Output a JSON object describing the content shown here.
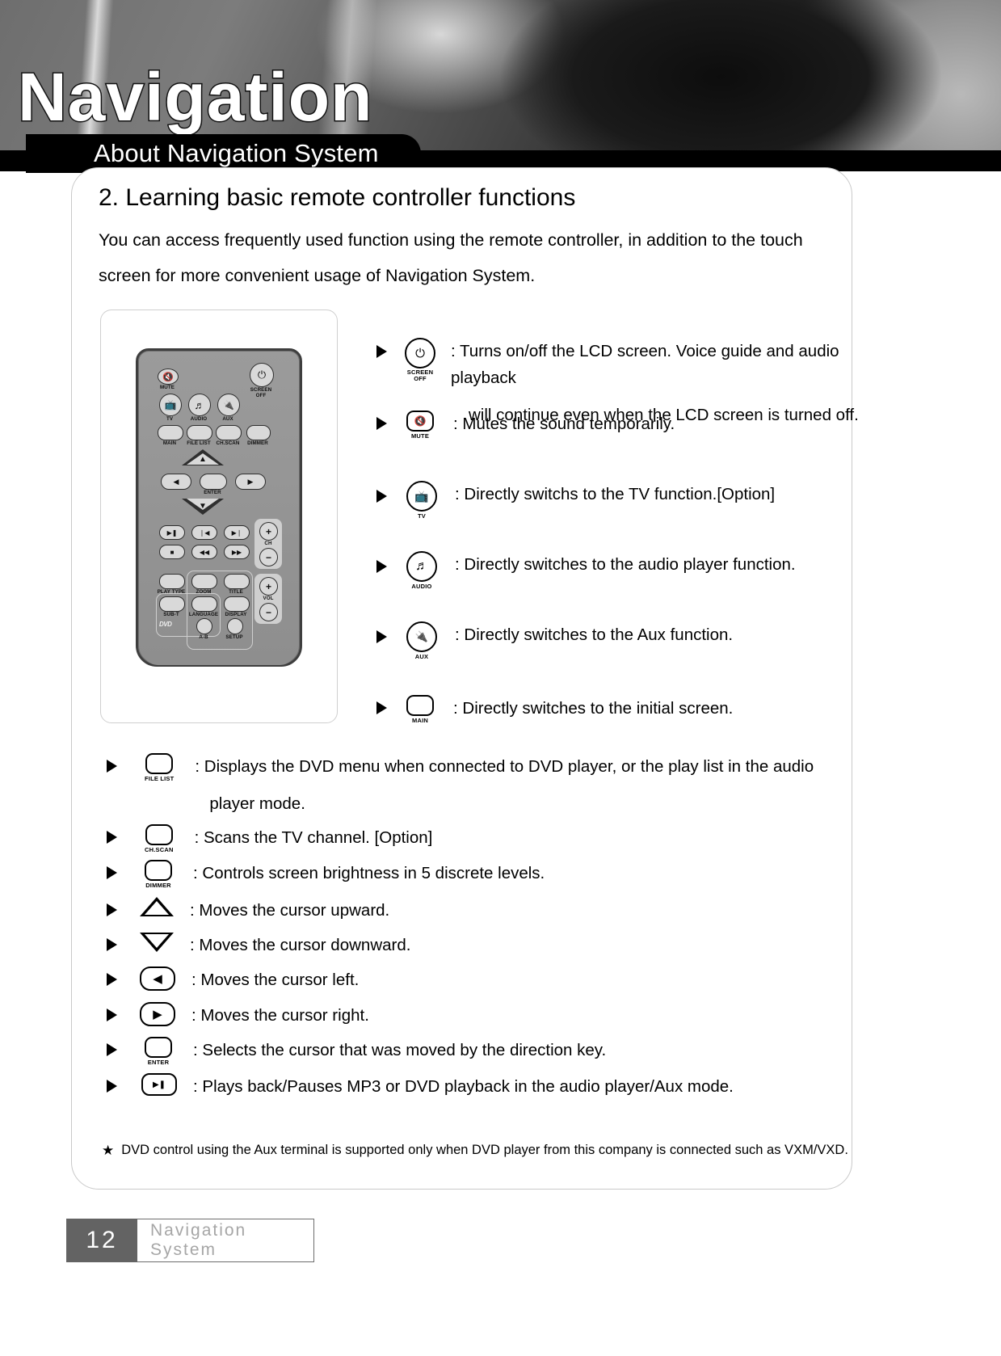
{
  "hero": {
    "title": "Navigation",
    "pill_label": "About Navigation System"
  },
  "section": {
    "heading": "2. Learning basic remote controller functions",
    "intro": "You can access frequently used function using the remote controller, in addition to the touch screen for more convenient usage of Navigation System."
  },
  "remote": {
    "buttons": [
      {
        "name": "mute",
        "label": "MUTE",
        "icon": "mute-icon"
      },
      {
        "name": "screen-off",
        "label": "SCREEN\nOFF",
        "icon": "power-icon"
      },
      {
        "name": "tv",
        "label": "TV",
        "icon": "tv-icon"
      },
      {
        "name": "audio",
        "label": "AUDIO",
        "icon": "music-note-icon"
      },
      {
        "name": "aux",
        "label": "AUX",
        "icon": "aux-plug-icon"
      },
      {
        "name": "main",
        "label": "MAIN",
        "icon": "blank-key-icon"
      },
      {
        "name": "file-list",
        "label": "FILE LIST",
        "icon": "blank-key-icon"
      },
      {
        "name": "ch-scan",
        "label": "CH.SCAN",
        "icon": "blank-key-icon"
      },
      {
        "name": "dimmer",
        "label": "DIMMER",
        "icon": "blank-key-icon"
      },
      {
        "name": "enter",
        "label": "ENTER",
        "icon": "blank-key-icon"
      },
      {
        "name": "play-type",
        "label": "PLAY TYPE",
        "icon": "blank-key-icon"
      },
      {
        "name": "zoom",
        "label": "ZOOM",
        "icon": "blank-key-icon"
      },
      {
        "name": "title",
        "label": "TITLE",
        "icon": "blank-key-icon"
      },
      {
        "name": "sub-t",
        "label": "SUB-T",
        "icon": "blank-key-icon"
      },
      {
        "name": "language",
        "label": "LANGUAGE",
        "icon": "blank-key-icon"
      },
      {
        "name": "display",
        "label": "DISPLAY",
        "icon": "blank-key-icon"
      },
      {
        "name": "a-b",
        "label": "A-B",
        "icon": "blank-key-icon"
      },
      {
        "name": "setup",
        "label": "SETUP",
        "icon": "blank-key-icon"
      },
      {
        "name": "ch",
        "label": "CH",
        "icon": "plus-minus-icon"
      },
      {
        "name": "vol",
        "label": "VOL",
        "icon": "plus-minus-icon"
      }
    ],
    "brand": "DVD",
    "ch_label": "CH",
    "vol_label": "VOL",
    "plus": "+",
    "minus": "−"
  },
  "right_list": [
    {
      "key": "SCREEN\nOFF",
      "icon": "power-icon",
      "text": ": Turns on/off the LCD screen. Voice guide and audio playback",
      "text2": "will continue even when the LCD screen is turned off."
    },
    {
      "key": "MUTE",
      "icon": "mute-icon",
      "text": ": Mutes the sound temporarily."
    },
    {
      "key": "TV",
      "icon": "tv-icon",
      "text": ": Directly switchs to the TV function.[Option]"
    },
    {
      "key": "AUDIO",
      "icon": "music-note-icon",
      "text": ": Directly switches to the audio player function."
    },
    {
      "key": "AUX",
      "icon": "aux-plug-icon",
      "text": ": Directly switches to the Aux function."
    },
    {
      "key": "MAIN",
      "icon": "blank-key-icon",
      "text": ": Directly switches to the initial screen."
    }
  ],
  "bottom_list": [
    {
      "key": "FILE LIST",
      "icon": "blank-key-icon",
      "text": ":  Displays the DVD menu when connected to DVD player, or the play list in the audio",
      "text2": "player mode."
    },
    {
      "key": "CH.SCAN",
      "icon": "blank-key-icon",
      "text": ":  Scans the TV channel. [Option]"
    },
    {
      "key": "DIMMER",
      "icon": "blank-key-icon",
      "text": ":  Controls screen brightness in 5 discrete levels."
    },
    {
      "key": "",
      "icon": "arrow-up-icon",
      "text": ":  Moves the cursor upward."
    },
    {
      "key": "",
      "icon": "arrow-down-icon",
      "text": ":  Moves the cursor downward."
    },
    {
      "key": "",
      "icon": "arrow-left-icon",
      "text": ":  Moves the cursor left."
    },
    {
      "key": "",
      "icon": "arrow-right-icon",
      "text": ":  Moves the cursor right."
    },
    {
      "key": "ENTER",
      "icon": "blank-key-icon",
      "text": ":  Selects the cursor that was moved by the direction key."
    },
    {
      "key": "",
      "icon": "play-pause-icon",
      "text": ":  Plays back/Pauses MP3 or DVD playback in the audio player/Aux mode."
    }
  ],
  "footnote": {
    "star": "★",
    "text": "DVD control using the Aux terminal is supported only when DVD player from this company is connected such as VXM/VXD."
  },
  "page_footer": {
    "number": "12",
    "name": "Navigation System"
  }
}
